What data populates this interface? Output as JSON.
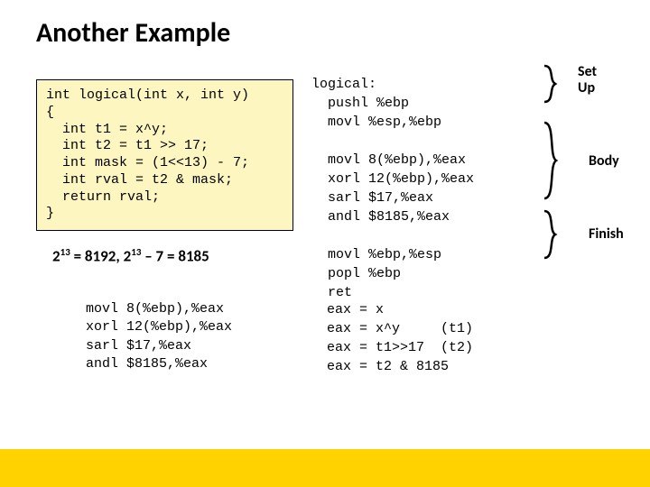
{
  "title": "Another Example",
  "c_code": "int logical(int x, int y)\n{\n  int t1 = x^y;\n  int t2 = t1 >> 17;\n  int mask = (1<<13) - 7;\n  int rval = t2 & mask;\n  return rval;\n}",
  "formula_html": "2<sup>13</sup> = 8192, 2<sup>13</sup> – 7 = 8185",
  "asm_bottom_left": "movl 8(%ebp),%eax\nxorl 12(%ebp),%eax\nsarl $17,%eax\nandl $8185,%eax",
  "asm_main": "logical:\n  pushl %ebp\n  movl %esp,%ebp\n\n  movl 8(%ebp),%eax\n  xorl 12(%ebp),%eax\n  sarl $17,%eax\n  andl $8185,%eax\n\n  movl %ebp,%esp\n  popl %ebp\n  ret",
  "trace": "eax = x\neax = x^y     (t1)\neax = t1>>17  (t2)\neax = t2 & 8185",
  "labels": {
    "setup": "Set\nUp",
    "body": "Body",
    "finish": "Finish"
  }
}
